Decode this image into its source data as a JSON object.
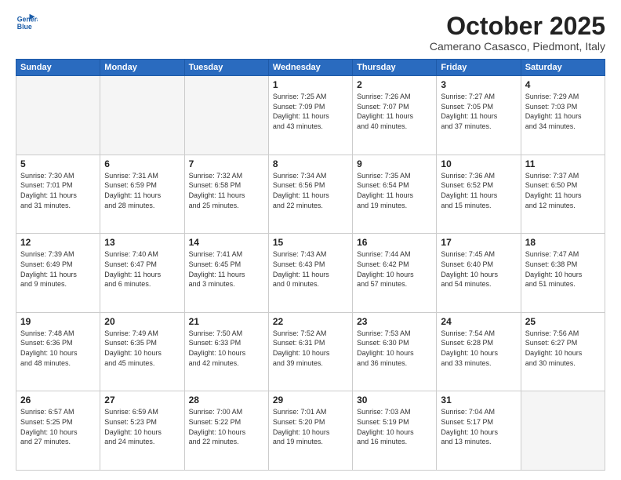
{
  "header": {
    "logo_line1": "General",
    "logo_line2": "Blue",
    "title": "October 2025",
    "subtitle": "Camerano Casasco, Piedmont, Italy"
  },
  "days_of_week": [
    "Sunday",
    "Monday",
    "Tuesday",
    "Wednesday",
    "Thursday",
    "Friday",
    "Saturday"
  ],
  "weeks": [
    [
      {
        "day": "",
        "empty": true
      },
      {
        "day": "",
        "empty": true
      },
      {
        "day": "",
        "empty": true
      },
      {
        "day": "1",
        "info": "Sunrise: 7:25 AM\nSunset: 7:09 PM\nDaylight: 11 hours\nand 43 minutes."
      },
      {
        "day": "2",
        "info": "Sunrise: 7:26 AM\nSunset: 7:07 PM\nDaylight: 11 hours\nand 40 minutes."
      },
      {
        "day": "3",
        "info": "Sunrise: 7:27 AM\nSunset: 7:05 PM\nDaylight: 11 hours\nand 37 minutes."
      },
      {
        "day": "4",
        "info": "Sunrise: 7:29 AM\nSunset: 7:03 PM\nDaylight: 11 hours\nand 34 minutes."
      }
    ],
    [
      {
        "day": "5",
        "info": "Sunrise: 7:30 AM\nSunset: 7:01 PM\nDaylight: 11 hours\nand 31 minutes."
      },
      {
        "day": "6",
        "info": "Sunrise: 7:31 AM\nSunset: 6:59 PM\nDaylight: 11 hours\nand 28 minutes."
      },
      {
        "day": "7",
        "info": "Sunrise: 7:32 AM\nSunset: 6:58 PM\nDaylight: 11 hours\nand 25 minutes."
      },
      {
        "day": "8",
        "info": "Sunrise: 7:34 AM\nSunset: 6:56 PM\nDaylight: 11 hours\nand 22 minutes."
      },
      {
        "day": "9",
        "info": "Sunrise: 7:35 AM\nSunset: 6:54 PM\nDaylight: 11 hours\nand 19 minutes."
      },
      {
        "day": "10",
        "info": "Sunrise: 7:36 AM\nSunset: 6:52 PM\nDaylight: 11 hours\nand 15 minutes."
      },
      {
        "day": "11",
        "info": "Sunrise: 7:37 AM\nSunset: 6:50 PM\nDaylight: 11 hours\nand 12 minutes."
      }
    ],
    [
      {
        "day": "12",
        "info": "Sunrise: 7:39 AM\nSunset: 6:49 PM\nDaylight: 11 hours\nand 9 minutes."
      },
      {
        "day": "13",
        "info": "Sunrise: 7:40 AM\nSunset: 6:47 PM\nDaylight: 11 hours\nand 6 minutes."
      },
      {
        "day": "14",
        "info": "Sunrise: 7:41 AM\nSunset: 6:45 PM\nDaylight: 11 hours\nand 3 minutes."
      },
      {
        "day": "15",
        "info": "Sunrise: 7:43 AM\nSunset: 6:43 PM\nDaylight: 11 hours\nand 0 minutes."
      },
      {
        "day": "16",
        "info": "Sunrise: 7:44 AM\nSunset: 6:42 PM\nDaylight: 10 hours\nand 57 minutes."
      },
      {
        "day": "17",
        "info": "Sunrise: 7:45 AM\nSunset: 6:40 PM\nDaylight: 10 hours\nand 54 minutes."
      },
      {
        "day": "18",
        "info": "Sunrise: 7:47 AM\nSunset: 6:38 PM\nDaylight: 10 hours\nand 51 minutes."
      }
    ],
    [
      {
        "day": "19",
        "info": "Sunrise: 7:48 AM\nSunset: 6:36 PM\nDaylight: 10 hours\nand 48 minutes."
      },
      {
        "day": "20",
        "info": "Sunrise: 7:49 AM\nSunset: 6:35 PM\nDaylight: 10 hours\nand 45 minutes."
      },
      {
        "day": "21",
        "info": "Sunrise: 7:50 AM\nSunset: 6:33 PM\nDaylight: 10 hours\nand 42 minutes."
      },
      {
        "day": "22",
        "info": "Sunrise: 7:52 AM\nSunset: 6:31 PM\nDaylight: 10 hours\nand 39 minutes."
      },
      {
        "day": "23",
        "info": "Sunrise: 7:53 AM\nSunset: 6:30 PM\nDaylight: 10 hours\nand 36 minutes."
      },
      {
        "day": "24",
        "info": "Sunrise: 7:54 AM\nSunset: 6:28 PM\nDaylight: 10 hours\nand 33 minutes."
      },
      {
        "day": "25",
        "info": "Sunrise: 7:56 AM\nSunset: 6:27 PM\nDaylight: 10 hours\nand 30 minutes."
      }
    ],
    [
      {
        "day": "26",
        "info": "Sunrise: 6:57 AM\nSunset: 5:25 PM\nDaylight: 10 hours\nand 27 minutes."
      },
      {
        "day": "27",
        "info": "Sunrise: 6:59 AM\nSunset: 5:23 PM\nDaylight: 10 hours\nand 24 minutes."
      },
      {
        "day": "28",
        "info": "Sunrise: 7:00 AM\nSunset: 5:22 PM\nDaylight: 10 hours\nand 22 minutes."
      },
      {
        "day": "29",
        "info": "Sunrise: 7:01 AM\nSunset: 5:20 PM\nDaylight: 10 hours\nand 19 minutes."
      },
      {
        "day": "30",
        "info": "Sunrise: 7:03 AM\nSunset: 5:19 PM\nDaylight: 10 hours\nand 16 minutes."
      },
      {
        "day": "31",
        "info": "Sunrise: 7:04 AM\nSunset: 5:17 PM\nDaylight: 10 hours\nand 13 minutes."
      },
      {
        "day": "",
        "empty": true
      }
    ]
  ]
}
